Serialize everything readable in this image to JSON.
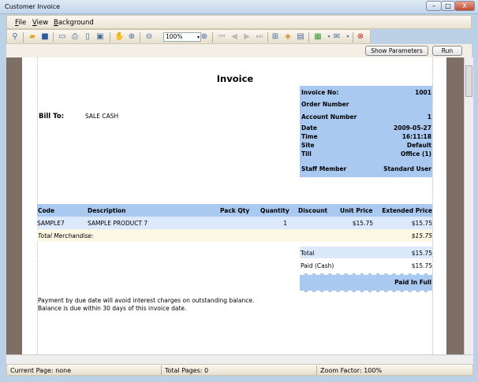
{
  "window": {
    "title": "Customer Invoice",
    "min": "–",
    "max": "□",
    "close": "X"
  },
  "menu": [
    "File",
    "View",
    "Background"
  ],
  "toolbar": {
    "zoom": "100%",
    "icons": [
      "find-icon",
      "open-icon",
      "save-icon",
      "page-setup-icon",
      "print-icon",
      "export-icon",
      "thumbnail-icon",
      "hand-icon",
      "zoom-in-icon",
      "zoom-out-icon",
      "zoom-in-2-icon",
      "first-page-icon",
      "prev-page-icon",
      "next-page-icon",
      "last-page-icon",
      "parameters-icon",
      "watermark-icon",
      "scale-icon",
      "export-doc-icon",
      "email-icon",
      "close-preview-icon"
    ]
  },
  "params": {
    "show": "Show Parameters",
    "run": "Run"
  },
  "report": {
    "title": "Invoice",
    "bill_to_label": "Bill To:",
    "bill_to": "SALE CASH",
    "info": [
      {
        "label": "Invoice No:",
        "value": "1001"
      },
      {
        "label": "Order Number",
        "value": ""
      },
      {
        "label": "Account Number",
        "value": "1"
      },
      {
        "label": "Date",
        "value": "2009-05-27"
      },
      {
        "label": "Time",
        "value": "16:11:18"
      },
      {
        "label": "Site",
        "value": "Default"
      },
      {
        "label": "Till",
        "value": "Office (1)"
      },
      {
        "label": "Staff Member",
        "value": "Standard User"
      }
    ],
    "columns": [
      "Code",
      "Description",
      "Pack Qty",
      "Quantity",
      "Discount",
      "Unit Price",
      "Extended Price"
    ],
    "rows": [
      {
        "code": "SAMPLE7",
        "desc": "SAMPLE PRODUCT 7",
        "pack": "",
        "qty": "1",
        "disc": "",
        "unit": "$15.75",
        "ext": "$15.75"
      }
    ],
    "total_merch_label": "Total Merchandise:",
    "total_merch": "$15.75",
    "total_label": "Total",
    "total": "$15.75",
    "paid_label": "Paid (Cash)",
    "paid": "$15.75",
    "paid_full": "Paid In Full",
    "footer": [
      "Payment by due date will avoid interest charges on outstanding balance.",
      "Balance is due within 30 days of this invoice date."
    ]
  },
  "status": {
    "page": "Current Page: none",
    "total": "Total Pages: 0",
    "zoom": "Zoom Factor: 100%"
  }
}
